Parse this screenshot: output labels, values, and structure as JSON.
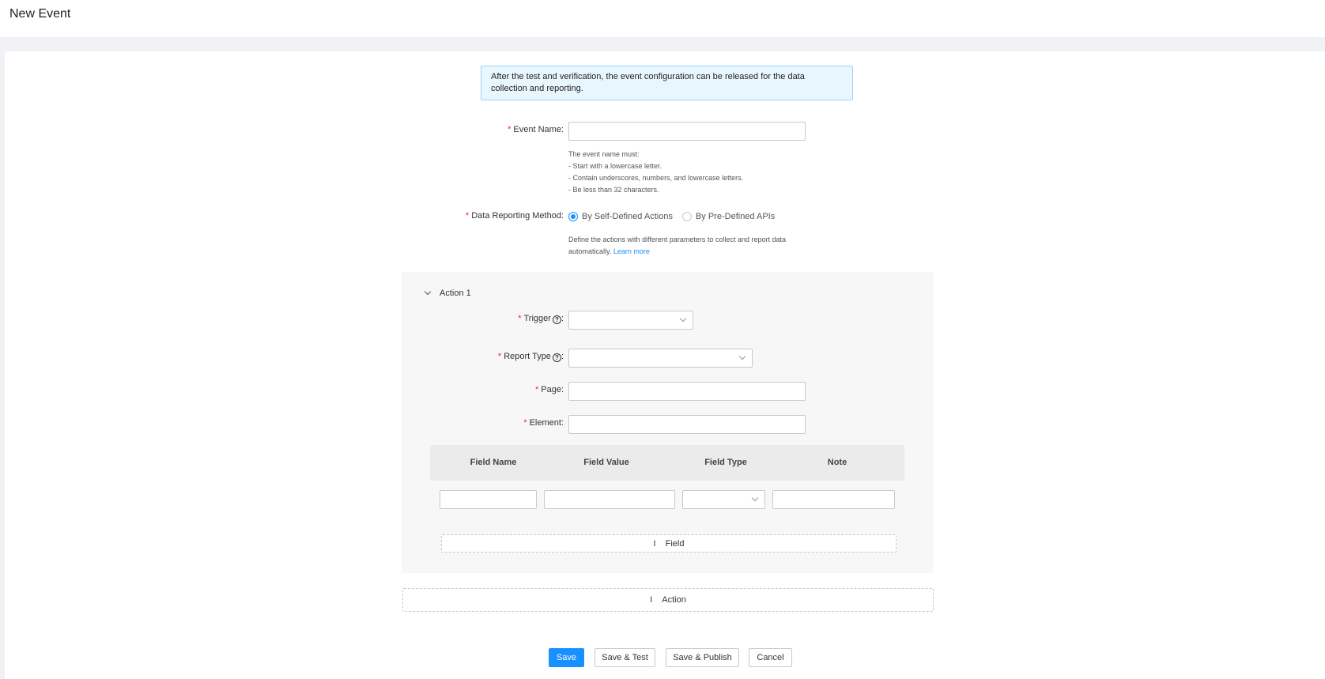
{
  "header": {
    "title": "New Event"
  },
  "alert": {
    "text": "After the test and verification, the event configuration can be released for the data collection and reporting."
  },
  "form": {
    "event_name": {
      "label": "Event Name:",
      "value": "",
      "help": [
        "The event name must:",
        "- Start with a lowercase letter.",
        "- Contain underscores, numbers, and lowercase letters.",
        "- Be less than 32 characters."
      ]
    },
    "reporting_method": {
      "label": "Data Reporting Method:",
      "options": [
        "By Self-Defined Actions",
        "By Pre-Defined APIs"
      ],
      "selected": "By Self-Defined Actions",
      "help": "Define the actions with different parameters to collect and report data automatically.",
      "help_link": "Learn more"
    }
  },
  "action": {
    "title": "Action 1",
    "trigger_label": "Trigger",
    "report_type_label": "Report Type",
    "page_label": "Page:",
    "element_label": "Element:",
    "field_table": {
      "columns": [
        "Field Name",
        "Field Value",
        "Field Type",
        "Note"
      ]
    },
    "add_field_label": "Field",
    "add_field_symbol": "I"
  },
  "add_action_label": "Action",
  "add_action_symbol": "I",
  "footer": {
    "save": "Save",
    "save_test": "Save & Test",
    "save_publish": "Save & Publish",
    "cancel": "Cancel"
  },
  "colors": {
    "primary": "#1890ff",
    "required": "#f5222d",
    "alert_bg": "#e8f6fe"
  }
}
